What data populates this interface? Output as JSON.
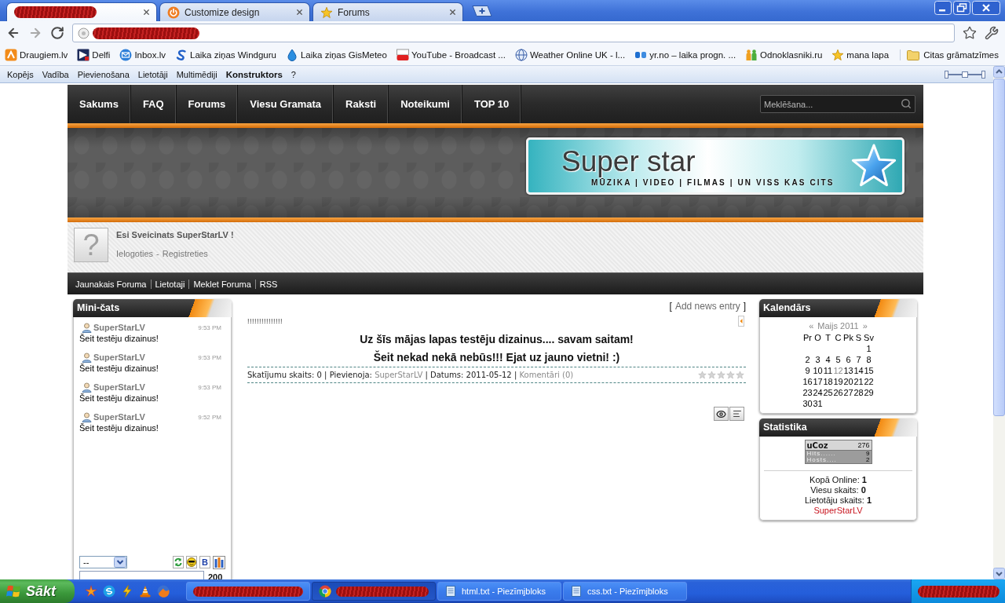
{
  "browser": {
    "tabs": [
      {
        "kind": "redacted",
        "selected": true
      },
      {
        "kind": "page",
        "title": "Customize design",
        "selected": false
      },
      {
        "kind": "page",
        "title": "Forums",
        "selected": false
      }
    ],
    "address_bar": {
      "kind": "redacted"
    },
    "bookmarks": [
      "Draugiem.lv",
      "Delfi",
      "Inbox.lv",
      "Laika ziņas Windguru",
      "Laika ziņas GisMeteo",
      "YouTube - Broadcast ...",
      "Weather Online UK - l...",
      "yr.no – laika progn. ...",
      "Odnoklasniki.ru",
      "mana lapa"
    ],
    "other_bookmarks": "Citas grāmatzīmes"
  },
  "admin_panel": {
    "items": [
      {
        "label": "Kopējs",
        "selected": false
      },
      {
        "label": "Vadība",
        "selected": false
      },
      {
        "label": "Pievienošana",
        "selected": false
      },
      {
        "label": "Lietotāji",
        "selected": false
      },
      {
        "label": "Multimēdiji",
        "selected": false
      },
      {
        "label": "Konstruktors",
        "selected": true
      },
      {
        "label": "?",
        "selected": false
      }
    ]
  },
  "site": {
    "nav": [
      "Sakums",
      "FAQ",
      "Forums",
      "Viesu Gramata",
      "Raksti",
      "Noteikumi",
      "TOP 10"
    ],
    "search": {
      "placeholder": "Meklēšana..."
    },
    "logo": {
      "title": "Super star",
      "tagline": "MŪZIKA | VIDEO | FILMAS | UN VISS KAS CITS"
    },
    "user_panel": {
      "avatar": "?",
      "greeting": "Esi Sveicinats SuperStarLV !",
      "links": [
        "Ielogoties",
        "Registreties"
      ],
      "separator": "-"
    },
    "sub_nav": [
      "Jaunakais Foruma",
      "Lietotaji",
      "Meklet Foruma",
      "RSS"
    ]
  },
  "mini_chat": {
    "title": "Mini-čats",
    "messages": [
      {
        "author": "SuperStarLV",
        "time": "9:53 PM",
        "text": "Šeit testēju dizainus!"
      },
      {
        "author": "SuperStarLV",
        "time": "9:53 PM",
        "text": "Šeit testēju dizainus!"
      },
      {
        "author": "SuperStarLV",
        "time": "9:53 PM",
        "text": "Šeit testēju dizainus!"
      },
      {
        "author": "SuperStarLV",
        "time": "9:52 PM",
        "text": "Šeit testēju dizainus!"
      }
    ],
    "select": {
      "value": "--"
    },
    "bold_button": "B",
    "counter": "200"
  },
  "news": {
    "add_link": {
      "open": "[",
      "label": "Add news entry",
      "close": "]"
    },
    "entries": [
      {
        "title": "!!!!!!!!!!!!!!!",
        "body": [
          "Uz šīs mājas lapas testēju dizainus.... savam saitam!",
          "Šeit nekad nekā nebūs!!! Ejat uz jauno vietni! :)"
        ],
        "meta": [
          {
            "kind": "text",
            "text": "Skatījumu skaits: 0 | Pievienoja:"
          },
          {
            "kind": "link",
            "text": "SuperStarLV"
          },
          {
            "kind": "text",
            "text": "| Datums: 2011-05-12 |"
          },
          {
            "kind": "link",
            "text": "Komentāri (0)"
          }
        ],
        "stars": 0
      }
    ]
  },
  "calendar": {
    "title": "Kalendārs",
    "prev": "«",
    "month": "Maijs 2011",
    "next": "»",
    "weekdays": [
      "Pr",
      "O",
      "T",
      "C",
      "Pk",
      "S",
      "Sv"
    ],
    "weeks": [
      [
        {
          "day": "1",
          "linked": false
        }
      ],
      [
        {
          "day": "2",
          "linked": false
        },
        {
          "day": "3",
          "linked": false
        },
        {
          "day": "4",
          "linked": false
        },
        {
          "day": "5",
          "linked": false
        },
        {
          "day": "6",
          "linked": false
        },
        {
          "day": "7",
          "linked": false
        },
        {
          "day": "8",
          "linked": false
        }
      ],
      [
        {
          "day": "9",
          "linked": false
        },
        {
          "day": "10",
          "linked": false
        },
        {
          "day": "11",
          "linked": false
        },
        {
          "day": "12",
          "linked": true
        },
        {
          "day": "13",
          "linked": false
        },
        {
          "day": "14",
          "linked": false
        },
        {
          "day": "15",
          "linked": false
        }
      ],
      [
        {
          "day": "16",
          "linked": false
        },
        {
          "day": "17",
          "linked": false
        },
        {
          "day": "18",
          "linked": false
        },
        {
          "day": "19",
          "linked": false
        },
        {
          "day": "20",
          "linked": false
        },
        {
          "day": "21",
          "linked": false
        },
        {
          "day": "22",
          "linked": false
        }
      ],
      [
        {
          "day": "23",
          "linked": false
        },
        {
          "day": "24",
          "linked": false
        },
        {
          "day": "25",
          "linked": false
        },
        {
          "day": "26",
          "linked": false
        },
        {
          "day": "27",
          "linked": false
        },
        {
          "day": "28",
          "linked": false
        },
        {
          "day": "29",
          "linked": false
        }
      ],
      [
        {
          "day": "30",
          "linked": false
        },
        {
          "day": "31",
          "linked": false
        }
      ]
    ]
  },
  "statistics": {
    "title": "Statistika",
    "counter": {
      "logo": "uCoz",
      "total": "276",
      "rows": [
        {
          "label": "Hits......",
          "value": "9"
        },
        {
          "label": "Hosts....",
          "value": "2"
        }
      ]
    },
    "lines": [
      {
        "label": "Kopā Online:",
        "value": "1"
      },
      {
        "label": "Viesu skaits:",
        "value": "0"
      },
      {
        "label": "Lietotāju skaits:",
        "value": "1"
      }
    ],
    "online_user": "SuperStarLV"
  },
  "taskbar": {
    "start": "Sākt",
    "tasks": [
      {
        "kind": "redacted",
        "selected": false
      },
      {
        "kind": "redacted",
        "selected": true
      },
      {
        "kind": "app",
        "title": "html.txt - Piezīmjbloks",
        "selected": false
      },
      {
        "kind": "app",
        "title": "css.txt - Piezīmjbloks",
        "selected": false
      }
    ],
    "tray": {
      "kind": "redacted"
    }
  }
}
